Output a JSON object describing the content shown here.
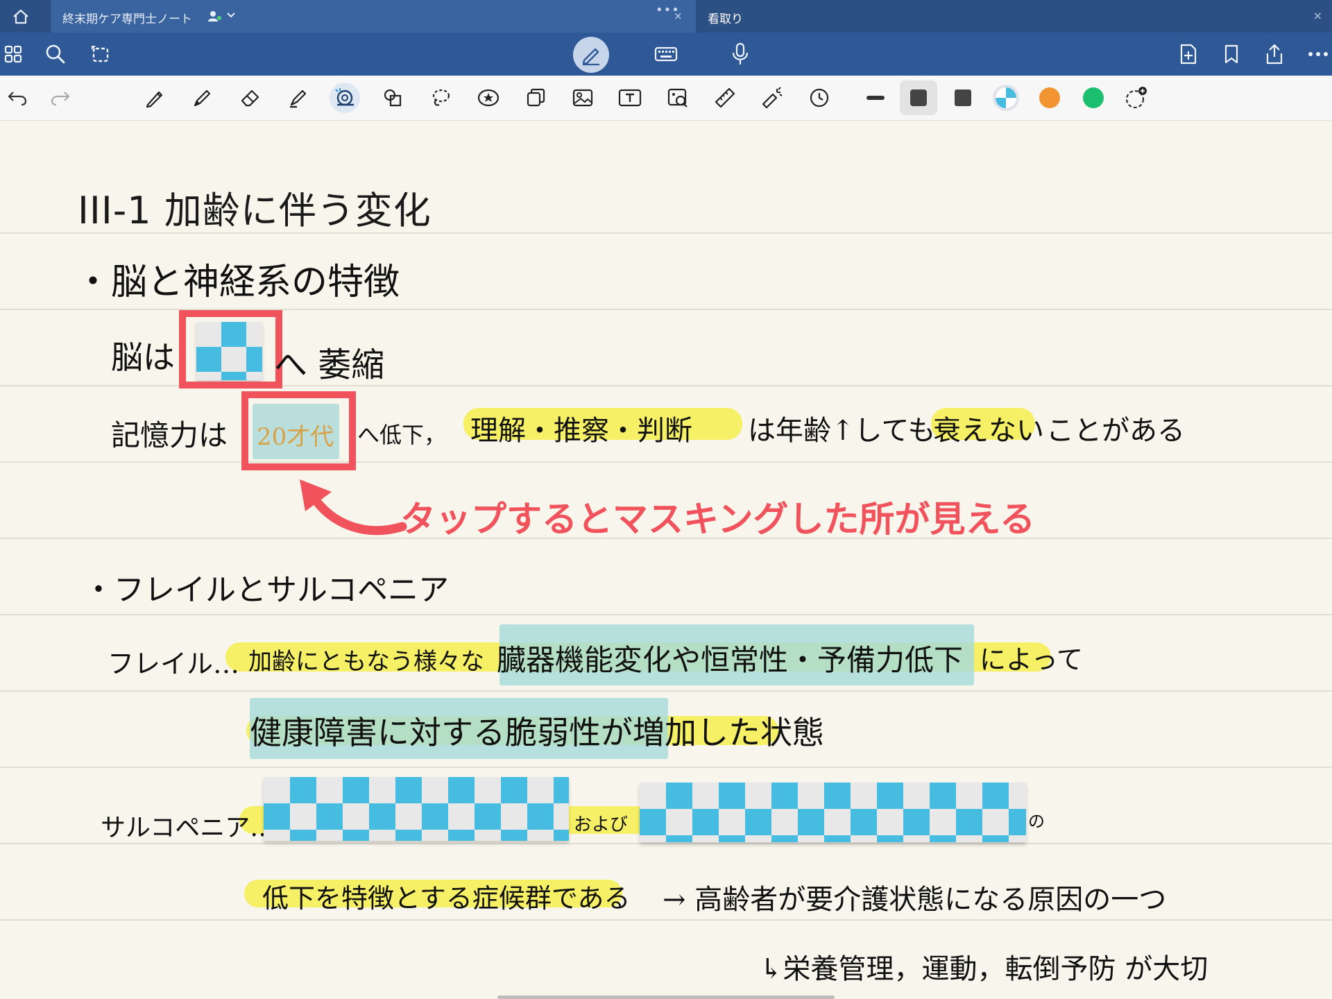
{
  "tabs": {
    "home_icon": "home-icon",
    "active_title": "終末期ケア専門士ノート",
    "active_menu_dots": "•••",
    "active_close": "×",
    "inactive_title": "看取り",
    "inactive_close": "×"
  },
  "toolbar": {
    "left_icons": [
      "grid-icon",
      "search-icon",
      "lasso-rotate-icon"
    ],
    "modes": [
      "pen-mode-icon",
      "keyboard-icon",
      "microphone-icon"
    ],
    "right_icons": [
      "add-page-icon",
      "bookmark-icon",
      "share-icon",
      "more-icon"
    ]
  },
  "tools": {
    "items": [
      "undo",
      "redo",
      "pen",
      "pencil",
      "eraser",
      "highlighter",
      "tape",
      "shapes",
      "lasso",
      "sticker",
      "elements",
      "image",
      "text",
      "camera",
      "ruler",
      "laser-pointer",
      "timer"
    ],
    "selected": "tape",
    "colors": [
      "#f39433",
      "#1bbf6e"
    ]
  },
  "note": {
    "title": "III-1 加齢に伴う変化",
    "heading1": "・脳と神経系の特徴",
    "line_brain_prefix": "脳は",
    "line_brain_suffix": "へ 萎縮",
    "line_memory_prefix": "記憶力は",
    "revealed_text": "20才代",
    "line_memory_mid": "へ低下，",
    "line_memory_hl": "理解・推察・判断",
    "line_memory_mid2": "は年齢↑しても",
    "line_memory_hl2": "衰えない",
    "line_memory_end": "ことがある",
    "annotation": "タップするとマスキングした所が見える",
    "heading2": "・フレイルとサルコペニア",
    "frail_label": "フレイル…",
    "frail_text": "加齢にともなう様々な",
    "frail_teal": "臓器機能変化や恒常性・予備力低下",
    "frail_end": "によって",
    "frail_line2": "健康障害に対する脆弱性が増加した状態",
    "sarco_label": "サルコペニア…",
    "sarco_mid": "および",
    "sarco_end": "の",
    "sarco_line2": "低下を特徴とする症候群である",
    "consequence": "→ 高齢者が要介護状態になる原因の一つ",
    "consequence2": "↳栄養管理，運動，転倒予防 が大切"
  }
}
